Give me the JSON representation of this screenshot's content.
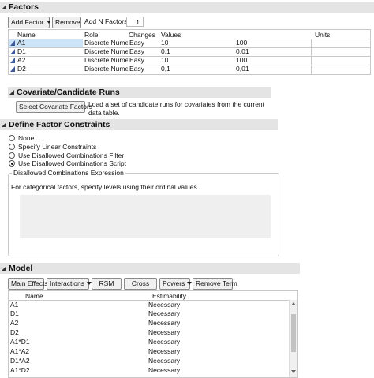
{
  "factors": {
    "title": "Factors",
    "add_factor_label": "Add Factor",
    "remove_label": "Remove",
    "add_n_label": "Add N Factors",
    "add_n_value": "1",
    "columns": [
      "Name",
      "Role",
      "Changes",
      "Values",
      "",
      "Units"
    ],
    "rows": [
      {
        "name": "A1",
        "role": "Discrete Numer",
        "changes": "Easy",
        "v1": "10",
        "v2": "100",
        "units": ""
      },
      {
        "name": "D1",
        "role": "Discrete Numer",
        "changes": "Easy",
        "v1": "0,1",
        "v2": "0,01",
        "units": ""
      },
      {
        "name": "A2",
        "role": "Discrete Numer",
        "changes": "Easy",
        "v1": "10",
        "v2": "100",
        "units": ""
      },
      {
        "name": "D2",
        "role": "Discrete Numer",
        "changes": "Easy",
        "v1": "0,1",
        "v2": "0,01",
        "units": ""
      }
    ]
  },
  "covariate": {
    "title": "Covariate/Candidate Runs",
    "button_label": "Select Covariate Factors",
    "description": "Load a set of candidate runs for covariates from the current data table."
  },
  "constraints": {
    "title": "Define Factor Constraints",
    "options": [
      "None",
      "Specify Linear Constraints",
      "Use Disallowed Combinations Filter",
      "Use Disallowed Combinations Script"
    ],
    "selected_index": 3,
    "expression_legend": "Disallowed Combinations Expression",
    "expression_hint": "For categorical factors, specify levels using their ordinal values."
  },
  "model": {
    "title": "Model",
    "buttons": {
      "main_effects": "Main Effects",
      "interactions": "Interactions",
      "rsm": "RSM",
      "cross": "Cross",
      "powers": "Powers",
      "remove_term": "Remove Term"
    },
    "columns": [
      "Name",
      "Estimability"
    ],
    "terms": [
      {
        "name": "A1",
        "estimability": "Necessary"
      },
      {
        "name": "D1",
        "estimability": "Necessary"
      },
      {
        "name": "A2",
        "estimability": "Necessary"
      },
      {
        "name": "D2",
        "estimability": "Necessary"
      },
      {
        "name": "A1*D1",
        "estimability": "Necessary"
      },
      {
        "name": "A1*A2",
        "estimability": "Necessary"
      },
      {
        "name": "D1*A2",
        "estimability": "Necessary"
      },
      {
        "name": "A1*D2",
        "estimability": "Necessary"
      }
    ]
  },
  "colors": {
    "header_bg": "#e4e4e4",
    "selection": "#cde3f7",
    "factor_icon": "#3c5a9a"
  }
}
